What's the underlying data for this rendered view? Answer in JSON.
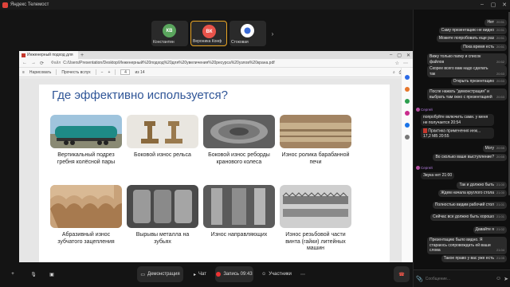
{
  "app": {
    "title": "Яндекс Телемост"
  },
  "participants": [
    {
      "initials": "КВ",
      "name": "Константин",
      "color": "#5aa55d",
      "active": false
    },
    {
      "initials": "ВК",
      "name": "Вероника Конф",
      "color": "#e8534a",
      "active": true
    },
    {
      "initials": "",
      "name": "Стоковая",
      "color": "#ffffff",
      "active": false
    }
  ],
  "browser": {
    "tab_title": "Инженерный подход для",
    "file_label": "Файл",
    "url": "C:/Users/Presentation/Desktop/Инженерный%20подход%20для%20увеличения%20ресурса%20узлов%20крана.pdf",
    "draw_label": "Нарисовать",
    "read_aloud_label": "Прочесть вслух",
    "page_current": "4",
    "page_total": "из 14"
  },
  "slide": {
    "title": "Где эффективно используется?",
    "cards": [
      {
        "caption": "Вертикальный подрез гребня колёсной пары",
        "image": "railway-tank-car"
      },
      {
        "caption": "Боковой износ рельса",
        "image": "rail-profile"
      },
      {
        "caption": "Боковой износ реборды кранового колеса",
        "image": "crane-wheel"
      },
      {
        "caption": "Износ ролика барабанной печи",
        "image": "kiln-roller"
      },
      {
        "caption": "Абразивный износ зубчатого зацепления",
        "image": "gear-teeth"
      },
      {
        "caption": "Вырывы металла на зубьях",
        "image": "gear-pitting"
      },
      {
        "caption": "Износ направляющих",
        "image": "guide-rails"
      },
      {
        "caption": "Износ резьбовой части винта (гайки) литейных машин",
        "image": "threaded-screw"
      }
    ]
  },
  "zoom_indicator": "Экран 4/14",
  "controls": {
    "demonstration": "Демонстрация",
    "chat": "Чат",
    "record": "Запись 09:43",
    "participants": "Участники"
  },
  "chat": {
    "messages": [
      {
        "type": "out",
        "text": "Нет",
        "time": "20:51"
      },
      {
        "type": "out",
        "text": "Саму презентацию не видно",
        "time": "20:51"
      },
      {
        "type": "out",
        "text": "Можете попробовать еще раз",
        "time": "20:51"
      },
      {
        "type": "out",
        "text": "Пока время есть",
        "time": "20:51"
      },
      {
        "type": "out",
        "text": "Вижу только папку и список файлов",
        "time": "20:52"
      },
      {
        "type": "out",
        "text": "Скорее всего вам надо сделать так",
        "time": "20:53"
      },
      {
        "type": "out",
        "text": "Открыть презентацию",
        "time": "20:53"
      },
      {
        "type": "out",
        "text": "После нажать \"демонстрация\" и выбрать там окно с презентацией",
        "time": "20:53"
      },
      {
        "type": "sender",
        "text": "Сергей"
      },
      {
        "type": "in",
        "text": "попробуйте включить сами. у меня не получается",
        "time": "20:54"
      },
      {
        "type": "in",
        "text": "Практика применения инж...",
        "time": "20:55"
      },
      {
        "type": "out",
        "text": "Могу",
        "time": "20:55"
      },
      {
        "type": "out",
        "text": "Во сколько ваше выступление?",
        "time": "20:55"
      },
      {
        "type": "sender",
        "text": "Сергей"
      },
      {
        "type": "in",
        "text": "Звука нет",
        "time": "21:00"
      },
      {
        "type": "out",
        "text": "Так и должно быть",
        "time": "21:00"
      },
      {
        "type": "out",
        "text": "Ждем начала круглого стола",
        "time": "21:00"
      },
      {
        "type": "out",
        "text": "Полностью видим рабочий стол",
        "time": "21:01"
      },
      {
        "type": "out",
        "text": "Сейчас все должно быть хорошо",
        "time": "21:01"
      },
      {
        "type": "out",
        "text": "Давайте я",
        "time": "21:02"
      },
      {
        "type": "out",
        "text": "Презентацию было видно. Я стараюсь сопровождать ей ваши слова",
        "time": "21:04"
      },
      {
        "type": "out",
        "text": "Такое право у вас уже есть",
        "time": "21:05"
      }
    ],
    "attachment_size": "17,2 МБ",
    "input_placeholder": "Сообщение..."
  }
}
